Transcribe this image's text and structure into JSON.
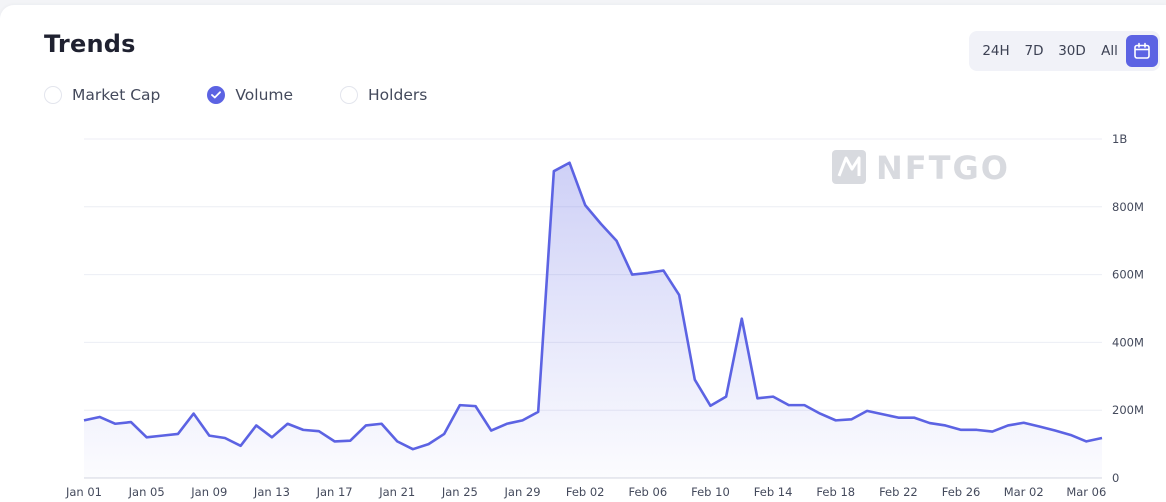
{
  "header": {
    "title": "Trends"
  },
  "legend": [
    {
      "label": "Market Cap",
      "checked": false
    },
    {
      "label": "Volume",
      "checked": true
    },
    {
      "label": "Holders",
      "checked": false
    }
  ],
  "range_buttons": [
    "24H",
    "7D",
    "30D",
    "All"
  ],
  "watermark": "NFTGO",
  "colors": {
    "accent": "#5c63e3",
    "line": "#5c63e3",
    "grid": "#eceef4",
    "text": "#444a5c"
  },
  "chart_data": {
    "type": "area",
    "title": "",
    "xlabel": "",
    "ylabel": "",
    "ylim": [
      0,
      1000000000
    ],
    "y_ticks": [
      0,
      200000000,
      400000000,
      600000000,
      800000000,
      1000000000
    ],
    "y_tick_labels": [
      "0",
      "200M",
      "400M",
      "600M",
      "800M",
      "1B"
    ],
    "x_tick_labels": [
      "Jan 01",
      "Jan 05",
      "Jan 09",
      "Jan 13",
      "Jan 17",
      "Jan 21",
      "Jan 25",
      "Jan 29",
      "Feb 02",
      "Feb 06",
      "Feb 10",
      "Feb 14",
      "Feb 18",
      "Feb 22",
      "Feb 26",
      "Mar 02",
      "Mar 06"
    ],
    "grid": true,
    "series": [
      {
        "values": [
          170000000,
          180000000,
          160000000,
          165000000,
          120000000,
          125000000,
          130000000,
          190000000,
          125000000,
          118000000,
          95000000,
          155000000,
          120000000,
          160000000,
          142000000,
          138000000,
          108000000,
          110000000,
          155000000,
          160000000,
          108000000,
          85000000,
          100000000,
          130000000,
          215000000,
          212000000,
          140000000,
          160000000,
          170000000,
          195000000,
          905000000,
          930000000,
          805000000,
          750000000,
          700000000,
          600000000,
          605000000,
          612000000,
          540000000,
          290000000,
          213000000,
          240000000,
          470000000,
          235000000,
          240000000,
          215000000,
          215000000,
          190000000,
          170000000,
          173000000,
          198000000,
          188000000,
          178000000,
          178000000,
          162000000,
          155000000,
          142000000,
          142000000,
          137000000,
          155000000,
          163000000,
          152000000,
          140000000,
          127000000,
          108000000,
          118000000
        ]
      }
    ]
  }
}
